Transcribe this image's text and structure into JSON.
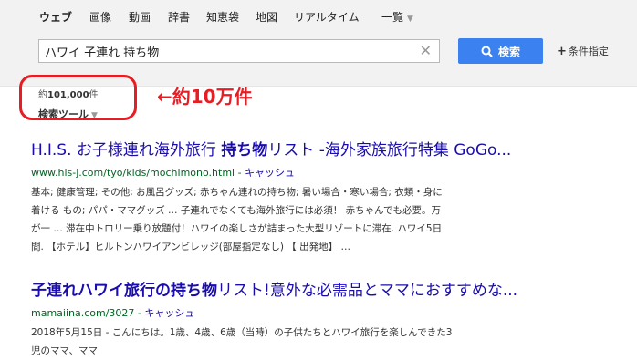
{
  "nav": {
    "items": [
      {
        "label": "ウェブ"
      },
      {
        "label": "画像"
      },
      {
        "label": "動画"
      },
      {
        "label": "辞書"
      },
      {
        "label": "知恵袋"
      },
      {
        "label": "地図"
      },
      {
        "label": "リアルタイム"
      },
      {
        "label": "一覧"
      }
    ]
  },
  "search": {
    "query": "ハワイ 子連れ 持ち物",
    "button_label": "検索",
    "conditions_label": "条件指定"
  },
  "stats": {
    "prefix": "約",
    "count": "101,000",
    "suffix": "件",
    "tools_label": "検索ツール"
  },
  "annotation": {
    "text": "←約10万件",
    "color": "#e81c23"
  },
  "results": [
    {
      "title_a": "H.I.S. お子様連れ海外旅行 ",
      "title_k": "持ち物",
      "title_b": "リスト -海外家族旅行特集 GoGo...",
      "url": "www.his-j.com/tyo/kids/mochimono.html",
      "cache": "キャッシュ",
      "snippet_lines": [
        "基本; 健康管理; その他; お風呂グッズ; 赤ちゃん連れの持ち物; 暑い場合・寒い場合; 衣類・身に",
        "着ける もの; パパ・ママグッズ … 子連れでなくても海外旅行には必須！ 赤ちゃんでも必要。万",
        "が一 … 滞在中トロリー乗り放題付！ハワイの楽しさが詰まった大型リゾートに滞在. ハワイ5日",
        "間. 【ホテル】ヒルトンハワイアンビレッジ(部屋指定なし) 【 出発地】 …"
      ]
    },
    {
      "title_a": "子連れハワイ旅行の",
      "title_k": "持ち物",
      "title_b": "リスト!意外な必需品とママにおすすめな...",
      "url": "mamaiina.com/3027",
      "cache": "キャッシュ",
      "snippet_lines": [
        "2018年5月15日 - こんにちは。1歳、4歳、6歳（当時）の子供たちとハワイ旅行を楽しんできた3",
        "児のママ、ママ"
      ]
    }
  ],
  "colors": {
    "link": "#1a0dab",
    "url": "#006621",
    "button": "#3b82f0",
    "annotation": "#e81c23"
  }
}
